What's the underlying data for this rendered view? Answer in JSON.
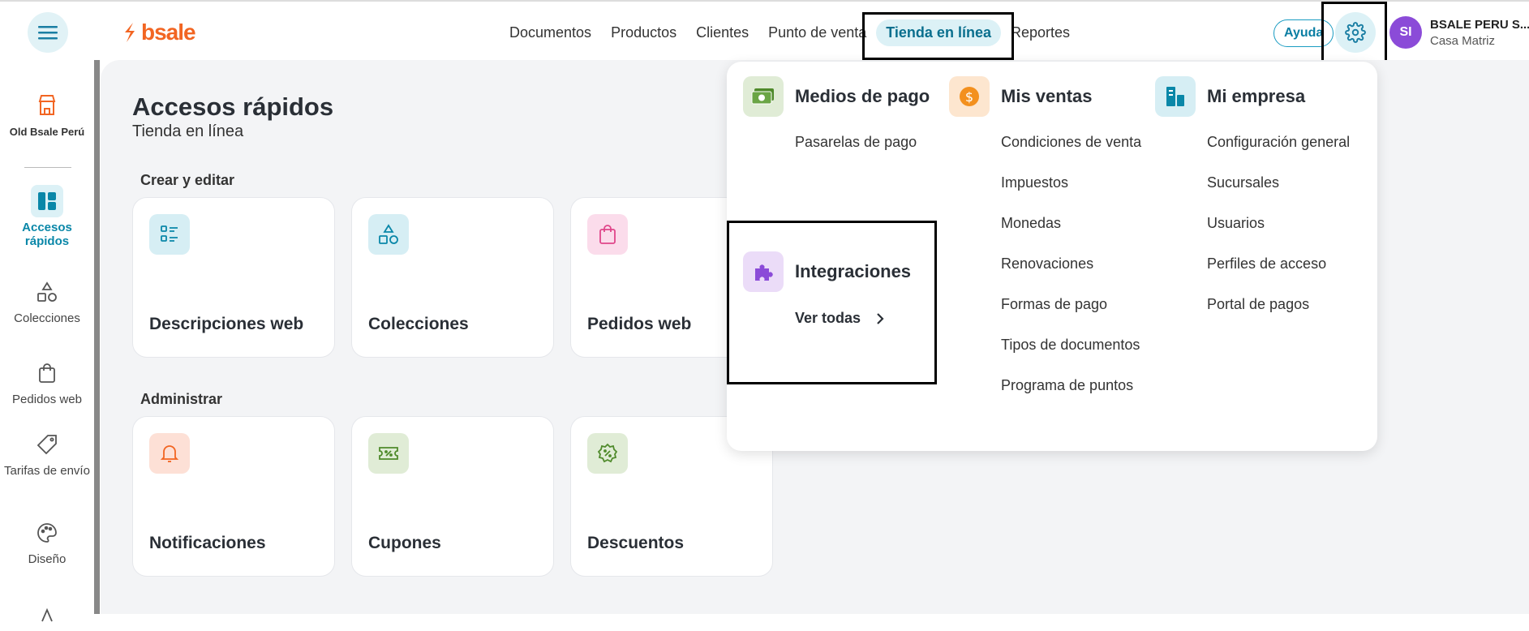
{
  "header": {
    "logo_text": "bsale",
    "nav": [
      "Documentos",
      "Productos",
      "Clientes",
      "Punto de venta",
      "Tienda en línea",
      "Reportes"
    ],
    "help_label": "Ayuda",
    "avatar_initials": "SI",
    "company_name": "BSALE PERU S....",
    "company_branch": "Casa Matriz"
  },
  "sidebar": {
    "store_label": "Old Bsale Perú",
    "items": [
      {
        "label": "Accesos rápidos",
        "icon": "dashboard-icon",
        "active": true
      },
      {
        "label": "Colecciones",
        "icon": "shapes-icon"
      },
      {
        "label": "Pedidos web",
        "icon": "bag-icon"
      },
      {
        "label": "Tarifas de envío",
        "icon": "tag-icon"
      },
      {
        "label": "Diseño",
        "icon": "palette-icon"
      }
    ]
  },
  "main": {
    "title": "Accesos rápidos",
    "subtitle": "Tienda en línea",
    "sections": [
      {
        "title": "Crear y editar",
        "cards": [
          {
            "label": "Descripciones web",
            "icon": "list-icon"
          },
          {
            "label": "Colecciones",
            "icon": "shapes-icon"
          },
          {
            "label": "Pedidos web",
            "icon": "bag-icon"
          }
        ]
      },
      {
        "title": "Administrar",
        "cards": [
          {
            "label": "Notificaciones",
            "icon": "bell-icon"
          },
          {
            "label": "Cupones",
            "icon": "coupon-icon"
          },
          {
            "label": "Descuentos",
            "icon": "discount-icon"
          }
        ]
      }
    ]
  },
  "settings_menu": {
    "medios": {
      "title": "Medios de pago",
      "items": [
        "Pasarelas de pago"
      ]
    },
    "ventas": {
      "title": "Mis ventas",
      "items": [
        "Condiciones de venta",
        "Impuestos",
        "Monedas",
        "Renovaciones",
        "Formas de pago",
        "Tipos de documentos",
        "Programa de puntos"
      ]
    },
    "empresa": {
      "title": "Mi empresa",
      "items": [
        "Configuración general",
        "Sucursales",
        "Usuarios",
        "Perfiles de acceso",
        "Portal de pagos"
      ]
    },
    "integraciones": {
      "title": "Integraciones",
      "link": "Ver todas"
    }
  },
  "colors": {
    "accent": "#0a87a8",
    "brand": "#f26522",
    "avatar": "#8b4bd8"
  }
}
